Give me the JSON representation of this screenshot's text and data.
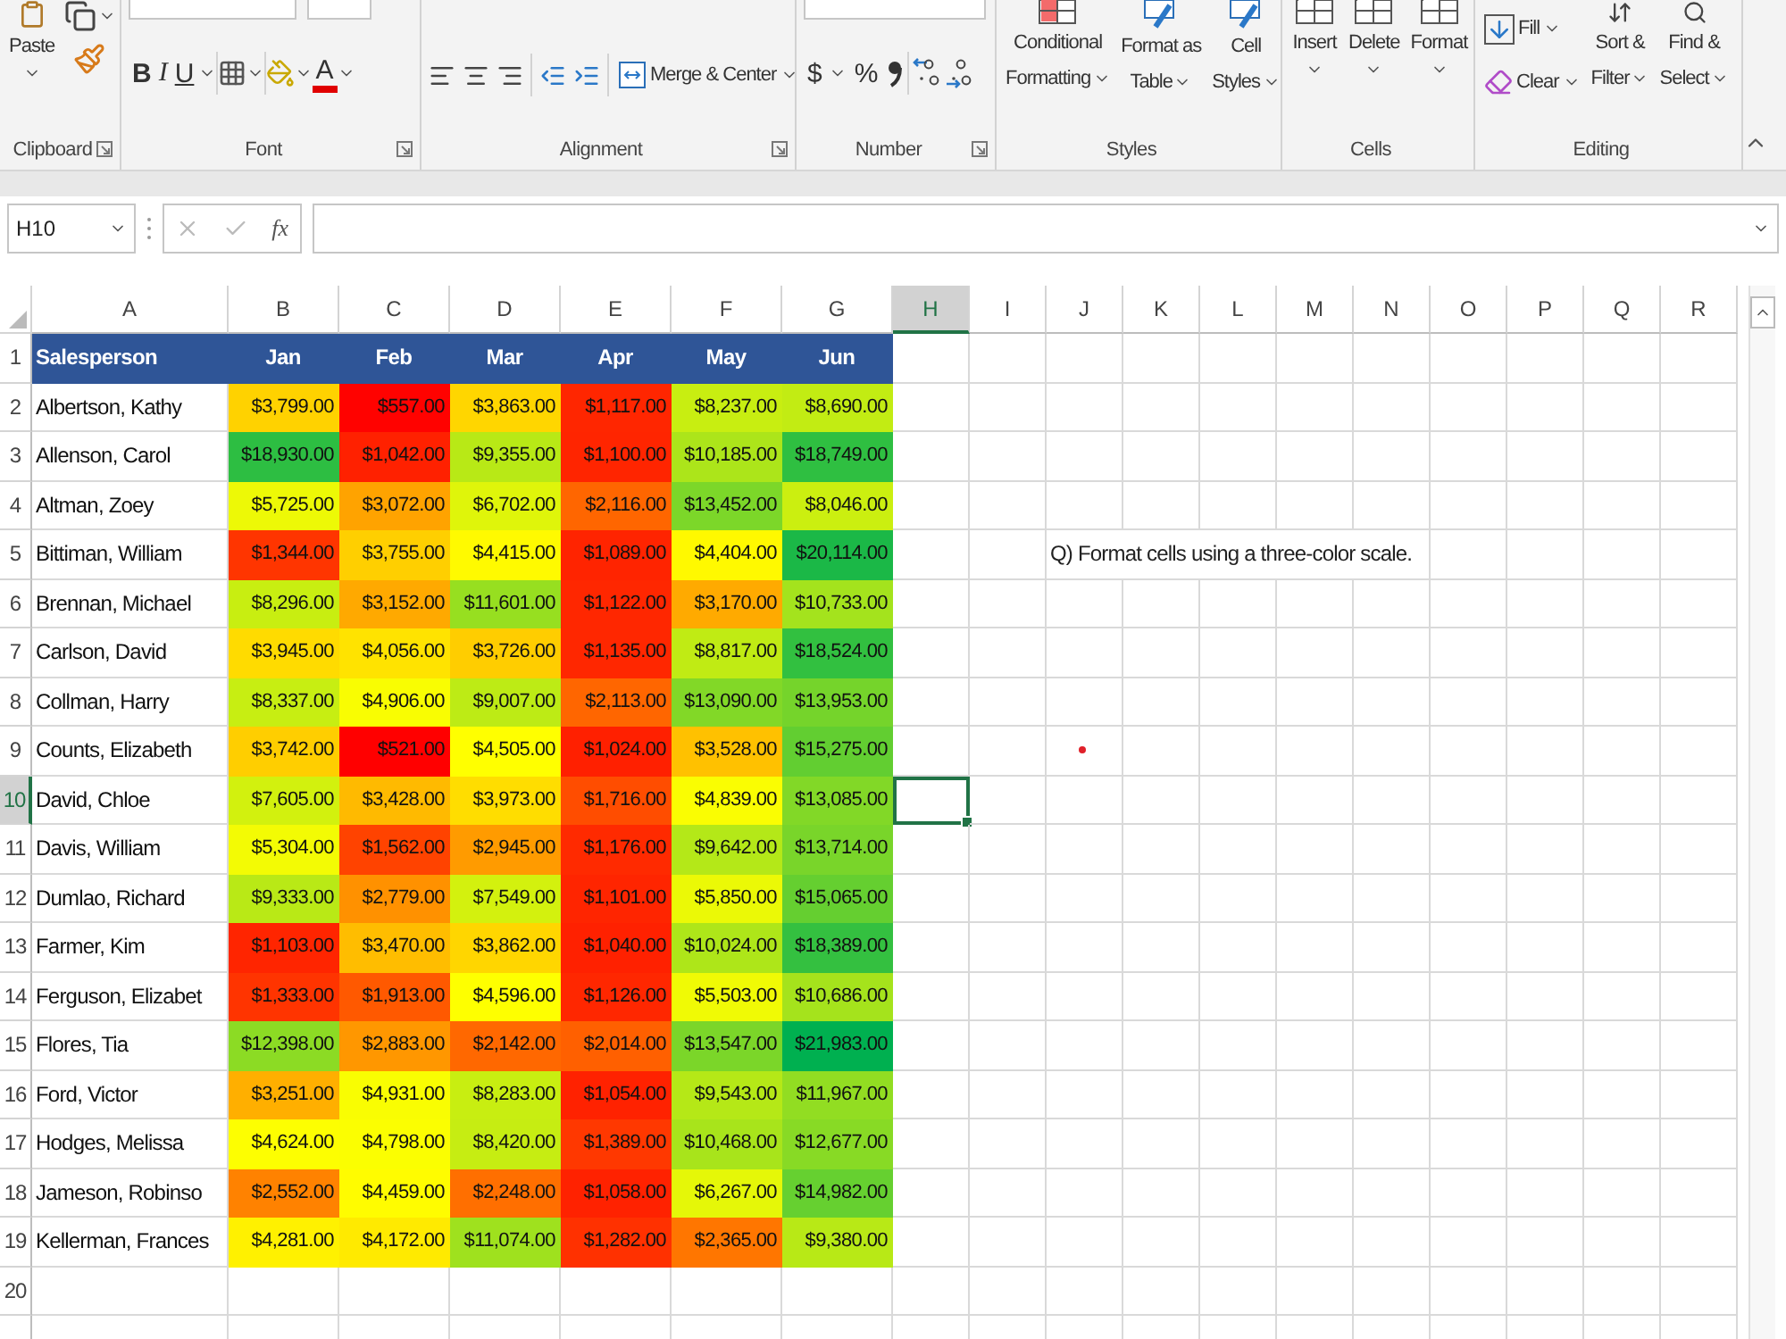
{
  "ribbon": {
    "clipboard": {
      "label": "Clipboard",
      "paste": "Paste"
    },
    "font": {
      "label": "Font",
      "bold": "B",
      "italic": "I",
      "underline": "U",
      "font_color": "A"
    },
    "alignment": {
      "label": "Alignment",
      "merge": "Merge & Center"
    },
    "number": {
      "label": "Number",
      "currency": "$",
      "percent": "%"
    },
    "styles": {
      "label": "Styles",
      "buttons": [
        [
          "Conditional",
          "Formatting"
        ],
        [
          "Format as",
          "Table"
        ],
        [
          "Cell",
          "Styles"
        ]
      ]
    },
    "cells": {
      "label": "Cells",
      "buttons": [
        "Insert",
        "Delete",
        "Format"
      ]
    },
    "editing": {
      "label": "Editing",
      "fill": "Fill",
      "clear": "Clear",
      "buttons": [
        [
          "Sort &",
          "Filter"
        ],
        [
          "Find &",
          "Select"
        ]
      ]
    }
  },
  "formula_bar": {
    "name_box": "H10",
    "fx": "fx"
  },
  "columns": [
    {
      "label": "A",
      "selected": false
    },
    {
      "label": "B",
      "selected": false
    },
    {
      "label": "C",
      "selected": false
    },
    {
      "label": "D",
      "selected": false
    },
    {
      "label": "E",
      "selected": false
    },
    {
      "label": "F",
      "selected": false
    },
    {
      "label": "G",
      "selected": false
    },
    {
      "label": "H",
      "selected": true
    },
    {
      "label": "I",
      "selected": false
    },
    {
      "label": "J",
      "selected": false
    },
    {
      "label": "K",
      "selected": false
    },
    {
      "label": "L",
      "selected": false
    },
    {
      "label": "M",
      "selected": false
    },
    {
      "label": "N",
      "selected": false
    },
    {
      "label": "O",
      "selected": false
    },
    {
      "label": "P",
      "selected": false
    },
    {
      "label": "Q",
      "selected": false
    },
    {
      "label": "R",
      "selected": false
    }
  ],
  "header_row": {
    "row": "1",
    "cells": [
      "Salesperson",
      "Jan",
      "Feb",
      "Mar",
      "Apr",
      "May",
      "Jun"
    ]
  },
  "rows": [
    {
      "row": "2",
      "name": "Albertson, Kathy",
      "selected": false,
      "cells": [
        {
          "text": "$3,799.00",
          "color": "#ffd200"
        },
        {
          "text": "$557.00",
          "color": "#ff0200"
        },
        {
          "text": "$3,863.00",
          "color": "#ffd600"
        },
        {
          "text": "$1,117.00",
          "color": "#ff2600"
        },
        {
          "text": "$8,237.00",
          "color": "#c8ee11"
        },
        {
          "text": "$8,690.00",
          "color": "#c2ec13"
        }
      ]
    },
    {
      "row": "3",
      "name": "Allenson, Carol",
      "selected": false,
      "cells": [
        {
          "text": "$18,930.00",
          "color": "#2dbe42"
        },
        {
          "text": "$1,042.00",
          "color": "#ff2100"
        },
        {
          "text": "$9,355.00",
          "color": "#b8e916"
        },
        {
          "text": "$1,100.00",
          "color": "#ff2500"
        },
        {
          "text": "$10,185.00",
          "color": "#ace51a"
        },
        {
          "text": "$18,749.00",
          "color": "#2fbf41"
        }
      ]
    },
    {
      "row": "4",
      "name": "Altman, Zoey",
      "selected": false,
      "cells": [
        {
          "text": "$5,725.00",
          "color": "#edf906"
        },
        {
          "text": "$3,072.00",
          "color": "#ffa300"
        },
        {
          "text": "$6,702.00",
          "color": "#dff50a"
        },
        {
          "text": "$2,116.00",
          "color": "#ff6600"
        },
        {
          "text": "$13,452.00",
          "color": "#7cd729"
        },
        {
          "text": "$8,046.00",
          "color": "#cbef10"
        }
      ]
    },
    {
      "row": "5",
      "name": "Bittiman, William",
      "selected": false,
      "note": "Q) Format cells using a three-color scale.",
      "cells": [
        {
          "text": "$1,344.00",
          "color": "#ff3500"
        },
        {
          "text": "$3,755.00",
          "color": "#ffcf00"
        },
        {
          "text": "$4,415.00",
          "color": "#fffa00"
        },
        {
          "text": "$1,089.00",
          "color": "#ff2400"
        },
        {
          "text": "$4,404.00",
          "color": "#fff900"
        },
        {
          "text": "$20,114.00",
          "color": "#1bb847"
        }
      ]
    },
    {
      "row": "6",
      "name": "Brennan, Michael",
      "selected": false,
      "cells": [
        {
          "text": "$8,296.00",
          "color": "#c8ee11"
        },
        {
          "text": "$3,152.00",
          "color": "#ffa900"
        },
        {
          "text": "$11,601.00",
          "color": "#97df20"
        },
        {
          "text": "$1,122.00",
          "color": "#ff2700"
        },
        {
          "text": "$3,170.00",
          "color": "#ffaa00"
        },
        {
          "text": "$10,733.00",
          "color": "#a4e31d"
        }
      ]
    },
    {
      "row": "7",
      "name": "Carlson, David",
      "selected": false,
      "cells": [
        {
          "text": "$3,945.00",
          "color": "#ffdb00"
        },
        {
          "text": "$4,056.00",
          "color": "#ffe300"
        },
        {
          "text": "$3,726.00",
          "color": "#ffcd00"
        },
        {
          "text": "$1,135.00",
          "color": "#ff2700"
        },
        {
          "text": "$8,817.00",
          "color": "#c0eb14"
        },
        {
          "text": "$18,524.00",
          "color": "#32c040"
        }
      ]
    },
    {
      "row": "8",
      "name": "Collman, Harry",
      "selected": false,
      "cells": [
        {
          "text": "$8,337.00",
          "color": "#c7ee12"
        },
        {
          "text": "$4,906.00",
          "color": "#f9fd02"
        },
        {
          "text": "$9,007.00",
          "color": "#bdeb15"
        },
        {
          "text": "$2,113.00",
          "color": "#ff6600"
        },
        {
          "text": "$13,090.00",
          "color": "#82d827"
        },
        {
          "text": "$13,953.00",
          "color": "#75d42b"
        }
      ]
    },
    {
      "row": "9",
      "name": "Counts, Elizabeth",
      "selected": false,
      "cells": [
        {
          "text": "$3,742.00",
          "color": "#ffce00"
        },
        {
          "text": "$521.00",
          "color": "#ff0000"
        },
        {
          "text": "$4,505.00",
          "color": "#ffff00"
        },
        {
          "text": "$1,024.00",
          "color": "#ff2000"
        },
        {
          "text": "$3,528.00",
          "color": "#ffc100"
        },
        {
          "text": "$15,275.00",
          "color": "#62ce31"
        }
      ]
    },
    {
      "row": "10",
      "name": "David, Chloe",
      "selected": true,
      "cells": [
        {
          "text": "$7,605.00",
          "color": "#d2f10e"
        },
        {
          "text": "$3,428.00",
          "color": "#ffba00"
        },
        {
          "text": "$3,973.00",
          "color": "#ffdd00"
        },
        {
          "text": "$1,716.00",
          "color": "#ff4d00"
        },
        {
          "text": "$4,839.00",
          "color": "#fafd02"
        },
        {
          "text": "$13,085.00",
          "color": "#82d827"
        }
      ]
    },
    {
      "row": "11",
      "name": "Davis, William",
      "selected": false,
      "cells": [
        {
          "text": "$5,304.00",
          "color": "#f3fb04"
        },
        {
          "text": "$1,562.00",
          "color": "#ff4300"
        },
        {
          "text": "$2,945.00",
          "color": "#ff9b00"
        },
        {
          "text": "$1,176.00",
          "color": "#ff2a00"
        },
        {
          "text": "$9,642.00",
          "color": "#b4e818"
        },
        {
          "text": "$13,714.00",
          "color": "#79d52a"
        }
      ]
    },
    {
      "row": "12",
      "name": "Dumlao, Richard",
      "selected": false,
      "cells": [
        {
          "text": "$9,333.00",
          "color": "#b9e916"
        },
        {
          "text": "$2,779.00",
          "color": "#ff9100"
        },
        {
          "text": "$7,549.00",
          "color": "#d3f10e"
        },
        {
          "text": "$1,101.00",
          "color": "#ff2500"
        },
        {
          "text": "$5,850.00",
          "color": "#ebf906"
        },
        {
          "text": "$15,065.00",
          "color": "#65cf30"
        }
      ]
    },
    {
      "row": "13",
      "name": "Farmer, Kim",
      "selected": false,
      "cells": [
        {
          "text": "$1,103.00",
          "color": "#ff2500"
        },
        {
          "text": "$3,470.00",
          "color": "#ffbd00"
        },
        {
          "text": "$3,862.00",
          "color": "#ffd600"
        },
        {
          "text": "$1,040.00",
          "color": "#ff2100"
        },
        {
          "text": "$10,024.00",
          "color": "#aee619"
        },
        {
          "text": "$18,389.00",
          "color": "#34c040"
        }
      ]
    },
    {
      "row": "14",
      "name": "Ferguson, Elizabet",
      "selected": false,
      "cells": [
        {
          "text": "$1,333.00",
          "color": "#ff3400"
        },
        {
          "text": "$1,913.00",
          "color": "#ff5900"
        },
        {
          "text": "$4,596.00",
          "color": "#feff00"
        },
        {
          "text": "$1,126.00",
          "color": "#ff2700"
        },
        {
          "text": "$5,503.00",
          "color": "#f0fa05"
        },
        {
          "text": "$10,686.00",
          "color": "#a5e31c"
        }
      ]
    },
    {
      "row": "15",
      "name": "Flores, Tia",
      "selected": false,
      "cells": [
        {
          "text": "$12,398.00",
          "color": "#8cdb24"
        },
        {
          "text": "$2,883.00",
          "color": "#ff9700"
        },
        {
          "text": "$2,142.00",
          "color": "#ff6800"
        },
        {
          "text": "$2,014.00",
          "color": "#ff6000"
        },
        {
          "text": "$13,547.00",
          "color": "#7bd629"
        },
        {
          "text": "$21,983.00",
          "color": "#00b050"
        }
      ]
    },
    {
      "row": "16",
      "name": "Ford, Victor",
      "selected": false,
      "cells": [
        {
          "text": "$3,251.00",
          "color": "#ffaf00"
        },
        {
          "text": "$4,931.00",
          "color": "#f9fd02"
        },
        {
          "text": "$8,283.00",
          "color": "#c8ee11"
        },
        {
          "text": "$1,054.00",
          "color": "#ff2200"
        },
        {
          "text": "$9,543.00",
          "color": "#b5e817"
        },
        {
          "text": "$11,967.00",
          "color": "#92dd22"
        }
      ]
    },
    {
      "row": "17",
      "name": "Hodges, Melissa",
      "selected": false,
      "cells": [
        {
          "text": "$4,624.00",
          "color": "#fdfe01"
        },
        {
          "text": "$4,798.00",
          "color": "#fbfe01"
        },
        {
          "text": "$8,420.00",
          "color": "#c6ed12"
        },
        {
          "text": "$1,389.00",
          "color": "#ff3800"
        },
        {
          "text": "$10,468.00",
          "color": "#a8e41b"
        },
        {
          "text": "$12,677.00",
          "color": "#88da25"
        }
      ]
    },
    {
      "row": "18",
      "name": "Jameson, Robinso",
      "selected": false,
      "cells": [
        {
          "text": "$2,552.00",
          "color": "#ff8200"
        },
        {
          "text": "$4,459.00",
          "color": "#fffc00"
        },
        {
          "text": "$2,248.00",
          "color": "#ff6f00"
        },
        {
          "text": "$1,058.00",
          "color": "#ff2200"
        },
        {
          "text": "$6,267.00",
          "color": "#e5f708"
        },
        {
          "text": "$14,982.00",
          "color": "#66d030"
        }
      ]
    },
    {
      "row": "19",
      "name": "Kellerman, Frances",
      "selected": false,
      "cells": [
        {
          "text": "$4,281.00",
          "color": "#fff100"
        },
        {
          "text": "$4,172.00",
          "color": "#ffea00"
        },
        {
          "text": "$11,074.00",
          "color": "#9fe11e"
        },
        {
          "text": "$1,282.00",
          "color": "#ff3100"
        },
        {
          "text": "$2,365.00",
          "color": "#ff7600"
        },
        {
          "text": "$9,380.00",
          "color": "#b8e916"
        }
      ]
    }
  ],
  "empty_rows": [
    "20"
  ]
}
